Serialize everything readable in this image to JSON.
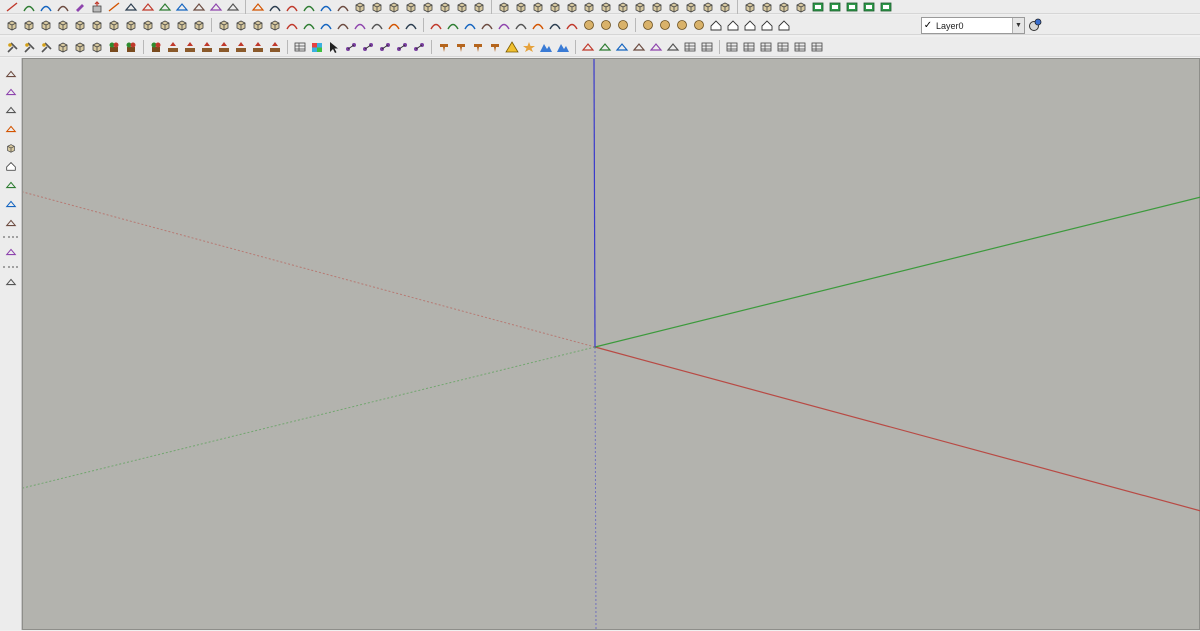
{
  "layers": {
    "current_layer": "Layer0"
  },
  "colors": {
    "viewport_bg": "#b3b3ae",
    "axis_red": "#b84a44",
    "axis_green": "#3c9a3c",
    "axis_blue": "#3a3acb"
  },
  "toolbar_row1_icons": [
    "freehand-icon",
    "arc-icon",
    "arc-icon",
    "arc-icon",
    "paint-icon",
    "extrude-icon",
    "line-icon",
    "shape-icon",
    "shape-icon",
    "shape-icon",
    "shape-icon",
    "shape-icon",
    "shape-icon",
    "shape-icon",
    "shape-icon",
    "curve-icon",
    "curve-icon",
    "curve-icon",
    "curve-icon",
    "curve-icon",
    "solid-icon",
    "solid-icon",
    "solid-icon",
    "solid-icon",
    "solid-icon",
    "solid-icon",
    "solid-icon",
    "solid-icon",
    "solid-icon",
    "solid-icon",
    "solid-icon",
    "solid-icon",
    "solid-icon",
    "solid-icon",
    "solid-icon",
    "solid-icon",
    "solid-icon",
    "solid-icon",
    "solid-icon",
    "solid-icon",
    "solid-icon",
    "solid-icon",
    "solid-icon",
    "solid-icon",
    "solid-icon",
    "solid-icon",
    "view-icon",
    "view-icon",
    "view-icon",
    "view-icon",
    "view-icon"
  ],
  "toolbar_row2_icons": [
    "cube-icon",
    "cube-icon",
    "cube-icon",
    "cube-icon",
    "cube-icon",
    "cube-icon",
    "cube-icon",
    "cube-icon",
    "cube-icon",
    "cube-icon",
    "cube-icon",
    "cube-icon",
    "cube-icon",
    "cube-icon",
    "cube-icon",
    "cube-icon",
    "curve-icon",
    "curve-icon",
    "curve-icon",
    "curve-icon",
    "curve-icon",
    "curve-icon",
    "curve-icon",
    "curve-icon",
    "curve-icon",
    "curve-icon",
    "curve-icon",
    "curve-icon",
    "curve-icon",
    "curve-icon",
    "curve-icon",
    "curve-icon",
    "curve-icon",
    "sphere-icon",
    "sphere-icon",
    "sphere-icon",
    "sphere-icon",
    "sphere-icon",
    "sphere-icon",
    "sphere-icon",
    "house-icon",
    "house-icon",
    "house-icon",
    "house-icon",
    "house-icon"
  ],
  "toolbar_row3_icons": [
    "tool-icon",
    "tool-icon",
    "tool-icon",
    "box-icon",
    "box-icon",
    "box-icon",
    "plant-icon",
    "plant-icon",
    "plant-icon",
    "arrow-icon",
    "arrow-icon",
    "arrow-icon",
    "arrow-icon",
    "arrow-icon",
    "arrow-icon",
    "arrow-icon",
    "grid-icon",
    "color-icon",
    "cursor-icon",
    "link-icon",
    "link-icon",
    "link-icon",
    "link-icon",
    "link-icon",
    "nail-icon",
    "nail-icon",
    "nail-icon",
    "nail-icon",
    "warning-icon",
    "star-icon",
    "mountain-icon",
    "mountain-icon",
    "shape-icon",
    "shape-icon",
    "shape-icon",
    "shape-icon",
    "shape-icon",
    "shape-icon",
    "stack-icon",
    "stack-icon",
    "stack-icon",
    "stack-icon",
    "stack-icon",
    "stack-icon",
    "stack-icon",
    "stack-icon"
  ],
  "left_toolbar_icons": [
    "select-icon",
    "move-icon",
    "plus-icon",
    "bucket-icon",
    "box-icon",
    "house-icon",
    "pen-icon",
    "camera-icon",
    "gear-icon",
    "section-icon",
    "brush-icon"
  ]
}
